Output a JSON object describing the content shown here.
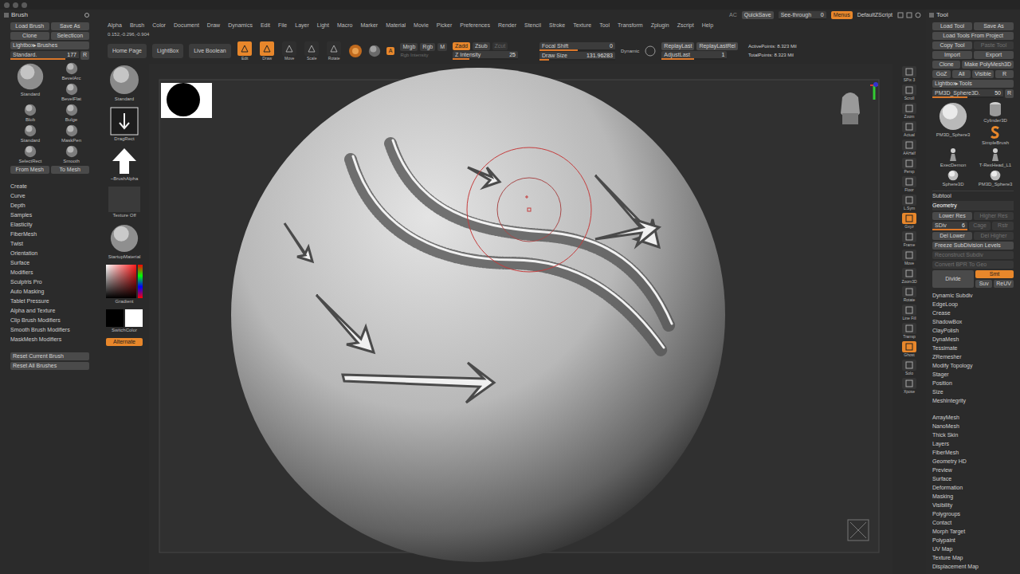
{
  "window": {
    "brush_title": "Brush",
    "tool_title": "Tool"
  },
  "header": {
    "ac": "AC",
    "quicksave": "QuickSave",
    "see_through_label": "See-through",
    "see_through_value": "0",
    "see_through_level": 0,
    "menus": "Menus",
    "menus_on": true,
    "script": "DefaultZScript"
  },
  "menu": [
    "Alpha",
    "Brush",
    "Color",
    "Document",
    "Draw",
    "Dynamics",
    "Edit",
    "File",
    "Layer",
    "Light",
    "Macro",
    "Marker",
    "Material",
    "Movie",
    "Picker",
    "Preferences",
    "Render",
    "Stencil",
    "Stroke",
    "Texture",
    "Tool",
    "Transform",
    "Zplugin",
    "Zscript",
    "Help"
  ],
  "coords": "0.152,-0.296,-0.904",
  "brush_palette": {
    "button_rows": [
      [
        "Load Brush",
        "Save As"
      ],
      [
        "Clone",
        "SelectIcon"
      ]
    ],
    "lightbox": "Lightbox▸Brushes",
    "current": {
      "label": "Standard.",
      "value": "177",
      "level": 0.8,
      "r": "R"
    },
    "brushes": [
      {
        "label": "Standard",
        "kind": "large"
      },
      {
        "label": "BevelArc",
        "kind": "small"
      },
      {
        "label": "BevelFlat",
        "kind": "small"
      },
      {
        "label": "Blob",
        "kind": "small"
      },
      {
        "label": "Bulge",
        "kind": "small"
      },
      {
        "label": "Standard",
        "kind": "small"
      },
      {
        "label": "MaskPen",
        "kind": "small"
      },
      {
        "label": "SelectRect",
        "kind": "small"
      },
      {
        "label": "Smooth",
        "kind": "small"
      }
    ],
    "mesh_buttons": [
      "From Mesh",
      "To Mesh"
    ],
    "subpalettes": [
      "Create",
      "Curve",
      "Depth",
      "Samples",
      "Elasticity",
      "FiberMesh",
      "Twist",
      "Orientation",
      "Surface",
      "Modifiers",
      "Sculptris Pro",
      "Auto Masking",
      "Tablet Pressure",
      "Alpha and Texture",
      "Clip Brush Modifiers",
      "Smooth Brush Modifiers",
      "MaskMesh Modifiers"
    ],
    "reset": [
      "Reset Current Brush",
      "Reset All Brushes"
    ]
  },
  "shelf": [
    {
      "label": "Standard",
      "kind": "brush"
    },
    {
      "label": "DragRect",
      "kind": "stroke"
    },
    {
      "label": "~BrushAlpha",
      "kind": "alpha"
    },
    {
      "label": "Texture Off",
      "kind": "texture"
    },
    {
      "label": "StartupMaterial",
      "kind": "material"
    },
    {
      "label": "Gradient",
      "kind": "color"
    },
    {
      "label": "SwitchColor",
      "kind": "swatch"
    }
  ],
  "alternate": {
    "label": "Alternate",
    "on": true
  },
  "top_shelf": {
    "nav": [
      "Home Page",
      "LightBox",
      "Live Boolean"
    ],
    "tools": [
      {
        "label": "Edit",
        "selected": true
      },
      {
        "label": "Draw",
        "selected": true
      },
      {
        "label": "Move",
        "selected": false
      },
      {
        "label": "Scale",
        "selected": false
      },
      {
        "label": "Rotate",
        "selected": false
      }
    ],
    "a": {
      "label": "A",
      "on": true
    },
    "color_modes": [
      {
        "label": "Mrgb",
        "selected": false
      },
      {
        "label": "Rgb",
        "selected": false
      },
      {
        "label": "M",
        "selected": false
      }
    ],
    "rgb_intensity": {
      "label": "Rgb Intensity",
      "disabled": true
    },
    "z_modes": [
      {
        "label": "Zadd",
        "selected": true,
        "disabled": false
      },
      {
        "label": "Zsub",
        "selected": false,
        "disabled": false
      },
      {
        "label": "Zcut",
        "selected": false,
        "disabled": true
      }
    ],
    "z_intensity": {
      "label": "Z Intensity",
      "value": "25",
      "level": 0.25
    },
    "focal_shift": {
      "label": "Focal Shift",
      "value": "0",
      "level": 0.5
    },
    "draw_size": {
      "label": "Draw Size",
      "value": "131.96283",
      "level": 0.13
    },
    "dynamic": "Dynamic",
    "replay": [
      "ReplayLast",
      "ReplayLastRel"
    ],
    "adjust_last": {
      "label": "AdjustLast",
      "value": "1",
      "level": 0.5
    },
    "active_points": "ActivePoints: 8.323 Mil",
    "total_points": "TotalPoints: 8.323 Mil"
  },
  "right_shelf": [
    {
      "label": "SPix 3",
      "selected": false
    },
    {
      "label": "Scroll",
      "selected": false
    },
    {
      "label": "Zoom",
      "selected": false
    },
    {
      "label": "Actual",
      "selected": false
    },
    {
      "label": "AAHalf",
      "selected": false
    },
    {
      "label": "Persp",
      "selected": false
    },
    {
      "label": "Floor",
      "selected": false
    },
    {
      "label": "L.Sym",
      "selected": false
    },
    {
      "label": "Gxyz",
      "selected": true
    },
    {
      "label": "Frame",
      "selected": false
    },
    {
      "label": "Move",
      "selected": false
    },
    {
      "label": "Zoom3D",
      "selected": false
    },
    {
      "label": "Rotate",
      "selected": false
    },
    {
      "label": "Line Fill",
      "selected": false
    },
    {
      "label": "Transp",
      "selected": false
    },
    {
      "label": "Ghost",
      "selected": true
    },
    {
      "label": "Solo",
      "selected": false
    },
    {
      "label": "Xpose",
      "selected": false
    }
  ],
  "tool_palette": {
    "button_rows": [
      [
        {
          "label": "Load Tool",
          "disabled": false
        },
        {
          "label": "Save As",
          "disabled": false
        }
      ],
      [
        {
          "label": "Load Tools From Project",
          "disabled": false
        }
      ],
      [
        {
          "label": "Copy Tool",
          "disabled": false
        },
        {
          "label": "Paste Tool",
          "disabled": true
        }
      ],
      [
        {
          "label": "Import",
          "disabled": false
        },
        {
          "label": "Export",
          "disabled": false
        }
      ],
      [
        {
          "label": "Clone",
          "disabled": false
        },
        {
          "label": "Make PolyMesh3D",
          "disabled": false
        }
      ],
      [
        {
          "label": "GoZ",
          "disabled": false
        },
        {
          "label": "All",
          "disabled": false
        },
        {
          "label": "Visible",
          "disabled": false
        },
        {
          "label": "R",
          "disabled": false
        }
      ]
    ],
    "lightbox": "Lightbox▸Tools",
    "current": {
      "label": "PM3D_Sphere3D.",
      "value": "50",
      "level": 0.5,
      "r": "R"
    },
    "tools": [
      {
        "label": "PM3D_Sphere3",
        "kind": "sphere"
      },
      {
        "label": "Cylinder3D",
        "kind": "cylinder"
      },
      {
        "label": "SimpleBrush",
        "kind": "brush"
      },
      {
        "label": "ExecDemon",
        "kind": "figure"
      },
      {
        "label": "T-RexHead_L1",
        "kind": "figure"
      },
      {
        "label": "Sphere3D",
        "kind": "small_sphere"
      },
      {
        "label": "PM3D_Sphere3",
        "kind": "small_sphere"
      }
    ],
    "subtool": "Subtool",
    "geometry": {
      "title": "Geometry",
      "expanded": true,
      "rows": [
        {
          "kind": "buttons",
          "buttons": [
            {
              "label": "Lower Res",
              "disabled": false
            },
            {
              "label": "Higher Res",
              "disabled": true
            }
          ]
        },
        {
          "kind": "slider",
          "label": "SDiv",
          "value": "6",
          "level": 1,
          "buttons": [
            {
              "label": "Cage",
              "disabled": true
            },
            {
              "label": "Rstr",
              "disabled": true
            }
          ]
        },
        {
          "kind": "buttons",
          "buttons": [
            {
              "label": "Del Lower",
              "disabled": false
            },
            {
              "label": "Del Higher",
              "disabled": true
            }
          ]
        },
        {
          "kind": "buttons",
          "buttons": [
            {
              "label": "Freeze SubDivision Levels",
              "disabled": false
            }
          ]
        },
        {
          "kind": "buttons",
          "buttons": [
            {
              "label": "Reconstruct Subdiv",
              "disabled": true
            }
          ]
        },
        {
          "kind": "buttons",
          "buttons": [
            {
              "label": "Convert BPR To Geo",
              "disabled": true
            }
          ]
        },
        {
          "kind": "divide",
          "label": "Divide",
          "toggles": [
            {
              "label": "Smt",
              "on": true
            },
            {
              "label": "Suv",
              "on": false
            },
            {
              "label": "ReUV",
              "on": false
            }
          ]
        }
      ],
      "subpalettes": [
        "Dynamic Subdiv",
        "EdgeLoop",
        "Crease",
        "ShadowBox",
        "ClayPolish",
        "DynaMesh",
        "Tessimate",
        "ZRemesher",
        "Modify Topology",
        "Stager",
        "Position",
        "Size",
        "MeshIntegrity"
      ]
    },
    "palettes": [
      "ArrayMesh",
      "NanoMesh",
      "Thick Skin",
      "Layers",
      "FiberMesh",
      "Geometry HD",
      "Preview",
      "Surface",
      "Deformation",
      "Masking",
      "Visibility",
      "Polygroups",
      "Contact",
      "Morph Target",
      "Polypaint",
      "UV Map",
      "Texture Map",
      "Displacement Map"
    ]
  }
}
